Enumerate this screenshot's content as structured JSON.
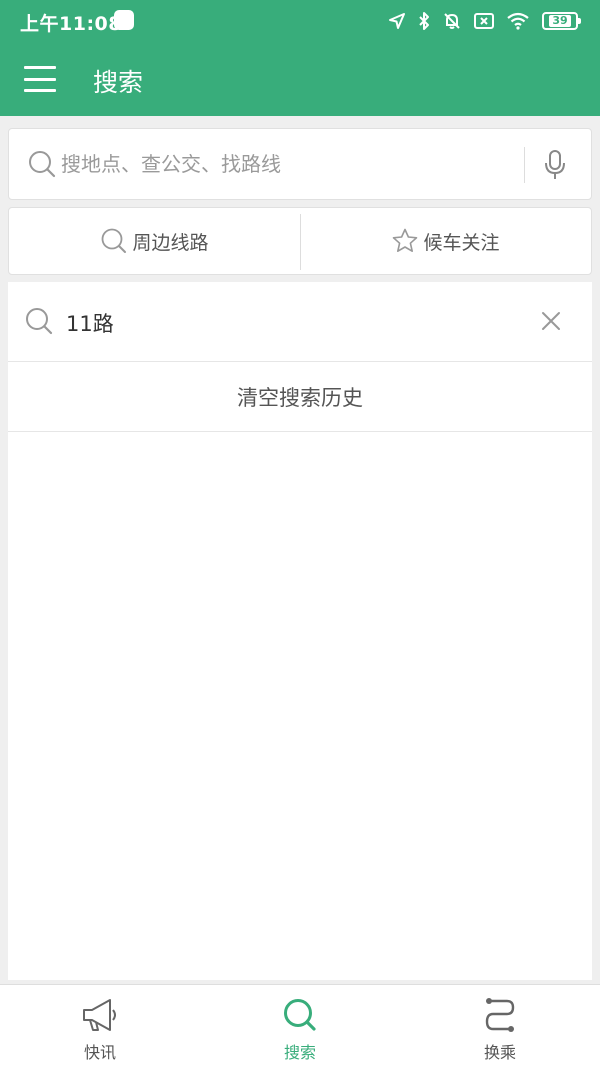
{
  "status_bar": {
    "time": "上午11:08",
    "battery": "39"
  },
  "toolbar": {
    "title": "搜索"
  },
  "search": {
    "placeholder": "搜地点、查公交、找路线",
    "value": ""
  },
  "tabs": [
    {
      "label": "周边线路",
      "icon": "search-icon"
    },
    {
      "label": "候车关注",
      "icon": "star-icon"
    }
  ],
  "history": {
    "items": [
      {
        "text": "11路"
      }
    ],
    "clear_label": "清空搜索历史"
  },
  "bottom_nav": {
    "items": [
      {
        "label": "快讯",
        "icon": "megaphone-icon"
      },
      {
        "label": "搜索",
        "icon": "search-icon",
        "active": true
      },
      {
        "label": "换乘",
        "icon": "route-icon"
      }
    ]
  },
  "colors": {
    "accent": "#38ad7b",
    "background": "#efefef"
  }
}
